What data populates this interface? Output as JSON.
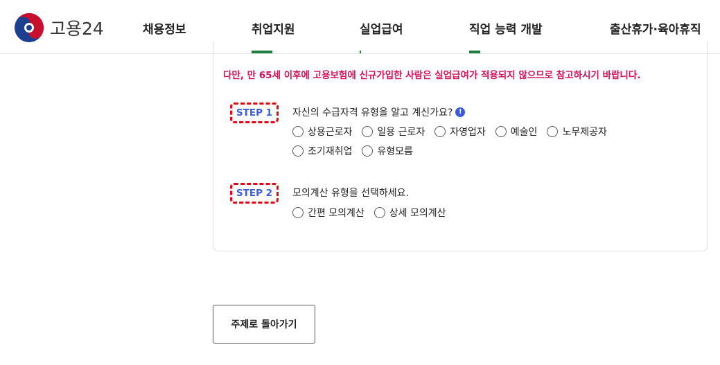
{
  "header": {
    "logo_text": "고용24",
    "nav": [
      {
        "label": "채용정보"
      },
      {
        "label": "취업지원"
      },
      {
        "label": "실업급여"
      },
      {
        "label": "직업 능력 개발"
      },
      {
        "label": "출산휴가·육아휴직"
      }
    ],
    "accent_color": "#1e7e3e"
  },
  "main": {
    "notice": "다만, 만 65세 이후에 고용보험에 신규가입한 사람은 실업급여가 적용되지 않으므로 참고하시기 바랍니다.",
    "step1": {
      "badge": "STEP 1",
      "question": "자신의 수급자격 유형을 알고 계신가요?",
      "info_icon": "info-icon",
      "options_row1": [
        "상용근로자",
        "일용 근로자",
        "자영업자",
        "예술인",
        "노무제공자"
      ],
      "options_row2": [
        "조기재취업",
        "유형모름"
      ]
    },
    "step2": {
      "badge": "STEP 2",
      "question": "모의계산 유형을 선택하세요.",
      "options": [
        "간편 모의계산",
        "상세 모의계산"
      ]
    },
    "back_button": "주제로 돌아가기"
  }
}
